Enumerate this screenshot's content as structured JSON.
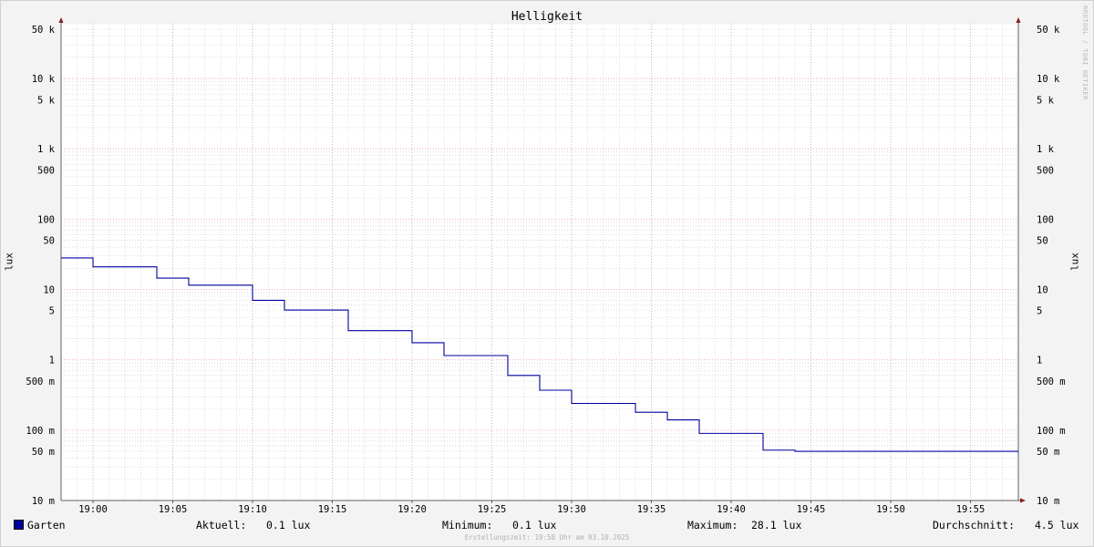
{
  "chart_data": {
    "type": "line",
    "title": "Helligkeit",
    "ylabel": "lux",
    "ylabel_right": "lux",
    "y_scale": "log",
    "ylim": [
      10,
      60000
    ],
    "ytick_values": [
      10,
      50,
      100,
      500,
      1,
      5,
      10,
      50,
      100,
      500,
      1000,
      5000,
      10000,
      50000
    ],
    "yticks": [
      {
        "value": 0.01,
        "label": "10 m"
      },
      {
        "value": 0.05,
        "label": "50 m"
      },
      {
        "value": 0.1,
        "label": "100 m"
      },
      {
        "value": 0.5,
        "label": "500 m"
      },
      {
        "value": 1,
        "label": "1"
      },
      {
        "value": 5,
        "label": "5"
      },
      {
        "value": 10,
        "label": "10"
      },
      {
        "value": 50,
        "label": "50"
      },
      {
        "value": 100,
        "label": "100"
      },
      {
        "value": 500,
        "label": "500"
      },
      {
        "value": 1000,
        "label": "1 k"
      },
      {
        "value": 5000,
        "label": "5 k"
      },
      {
        "value": 10000,
        "label": "10 k"
      },
      {
        "value": 50000,
        "label": "50 k"
      }
    ],
    "xlim": [
      "18:58",
      "19:58"
    ],
    "xticks": [
      "19:00",
      "19:05",
      "19:10",
      "19:15",
      "19:20",
      "19:25",
      "19:30",
      "19:35",
      "19:40",
      "19:45",
      "19:50",
      "19:55"
    ],
    "grid": true,
    "series": [
      {
        "name": "Garten",
        "color": "#0000a0",
        "step": true,
        "x": [
          "18:58",
          "19:00",
          "19:04",
          "19:06",
          "19:10",
          "19:12",
          "19:16",
          "19:20",
          "19:22",
          "19:26",
          "19:28",
          "19:30",
          "19:34",
          "19:36",
          "19:38",
          "19:42",
          "19:44"
        ],
        "values": [
          28.1,
          21,
          14.5,
          11.5,
          7,
          5.1,
          2.6,
          1.75,
          1.15,
          0.6,
          0.37,
          0.24,
          0.18,
          0.14,
          0.09,
          0.052,
          0.05
        ],
        "x_end": "19:58"
      }
    ]
  },
  "legend": {
    "series_name": "Garten",
    "current_label": "Aktuell:",
    "current_value": "0.1 lux",
    "min_label": "Minimum:",
    "min_value": "0.1 lux",
    "max_label": "Maximum:",
    "max_value": "28.1 lux",
    "avg_label": "Durchschnitt:",
    "avg_value": "4.5 lux"
  },
  "watermark": "RRDTOOL / TOBI OETIKER",
  "footer": "Erstellungszeit: 19:58 Uhr am 03.10.2025",
  "colors": {
    "series": "#0000a0",
    "major_grid": "#e6a0a0",
    "minor_grid": "#c8c8c8",
    "axis": "#606060",
    "arrow": "#8b1a1a",
    "background": "#f3f3f3",
    "canvas": "#ffffff"
  }
}
